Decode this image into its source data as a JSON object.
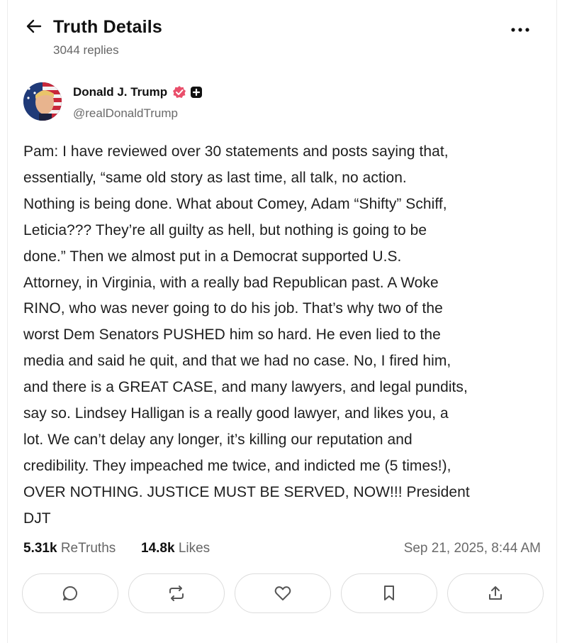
{
  "header": {
    "title": "Truth Details",
    "replies": "3044 replies"
  },
  "icons": {
    "back": "arrow-left-icon",
    "more": "more-horizontal-icon",
    "verified": "verified-badge-icon",
    "plus": "plus-badge-icon",
    "reply": "reply-icon",
    "retruth": "retruth-icon",
    "like": "heart-icon",
    "bookmark": "bookmark-icon",
    "share": "share-icon"
  },
  "author": {
    "name": "Donald J. Trump",
    "handle": "@realDonaldTrump"
  },
  "post": {
    "text": "Pam: I have reviewed over 30 statements and posts saying that,\nessentially, “same old story as last time, all talk, no action.\nNothing is being done. What about Comey, Adam “Shifty” Schiff,\nLeticia??? They’re all guilty as hell, but nothing is going to be\ndone.” Then we almost put in a Democrat supported U.S.\nAttorney, in Virginia, with a really bad Republican past. A Woke\nRINO, who was never going to do his job. That’s why two of the\nworst Dem Senators PUSHED him so hard. He even lied to the\nmedia and said he quit, and that we had no case. No, I fired him,\nand there is a GREAT CASE, and many lawyers, and legal pundits,\nsay so. Lindsey Halligan is a really good lawyer, and likes you, a\nlot. We can’t delay any longer, it’s killing our reputation and\ncredibility. They impeached me twice, and indicted me (5 times!),\nOVER NOTHING. JUSTICE MUST BE SERVED, NOW!!! President\nDJT"
  },
  "stats": {
    "retruths_count": "5.31k",
    "retruths_label": "ReTruths",
    "likes_count": "14.8k",
    "likes_label": "Likes",
    "timestamp": "Sep 21, 2025, 8:44 AM"
  },
  "colors": {
    "verified_badge": "#e94f6b",
    "border": "#dcdcdc",
    "icon": "#555555",
    "muted_text": "#666666"
  }
}
